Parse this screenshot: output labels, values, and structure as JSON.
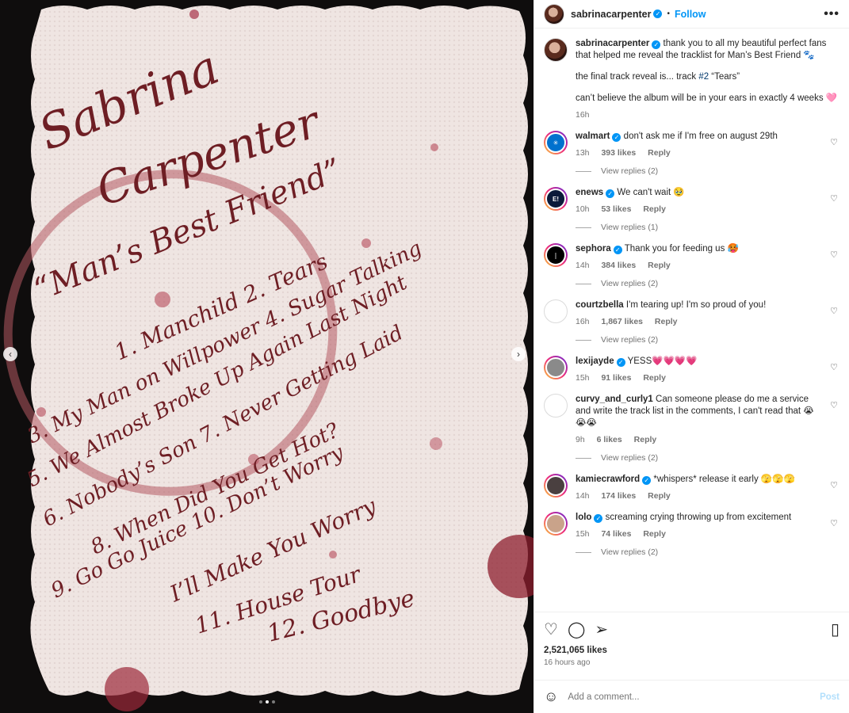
{
  "post": {
    "author": "sabrinacarpenter",
    "follow_label": "Follow",
    "more_label": "•••",
    "separator": "•"
  },
  "caption": {
    "author": "sabrinacarpenter",
    "line1": "thank you to all my beautiful perfect fans that helped me reveal the tracklist for Man’s Best Friend 🐾",
    "line2_pre": "the final track reveal is... track ",
    "line2_tag": "#2",
    "line2_post": " “Tears”",
    "line3": "can’t believe the album will be in your ears in exactly 4 weeks 🩷",
    "time": "16h"
  },
  "comments": [
    {
      "user": "walmart",
      "verified": true,
      "text": "don't ask me if I'm free on august 29th",
      "time": "13h",
      "likes": "393 likes",
      "reply": "Reply",
      "replies": "View replies (2)",
      "avatar_icon": "walmart-spark-icon",
      "avatar_color": "#0071ce"
    },
    {
      "user": "enews",
      "verified": true,
      "text": "We can't wait 🥹",
      "time": "10h",
      "likes": "53 likes",
      "reply": "Reply",
      "replies": "View replies (1)",
      "avatar_icon": "enews-logo-icon",
      "avatar_color": "#0b1a3a"
    },
    {
      "user": "sephora",
      "verified": true,
      "text": "Thank you for feeding us 🥵",
      "time": "14h",
      "likes": "384 likes",
      "reply": "Reply",
      "replies": "View replies (2)",
      "avatar_icon": "sephora-flame-icon",
      "avatar_color": "#000000"
    },
    {
      "user": "courtzbella",
      "verified": false,
      "text": "I'm tearing up! I'm so proud of you!",
      "time": "16h",
      "likes": "1,867 likes",
      "reply": "Reply",
      "replies": "View replies (2)",
      "avatar_icon": "user-photo-icon",
      "avatar_color": "#3a3230"
    },
    {
      "user": "lexijayde",
      "verified": true,
      "text": "YESS💗💗💗💗",
      "time": "15h",
      "likes": "91 likes",
      "reply": "Reply",
      "replies": "",
      "avatar_icon": "user-photo-icon",
      "avatar_color": "#8a8a8a"
    },
    {
      "user": "curvy_and_curly1",
      "verified": false,
      "text": "Can someone please do me a service and write the track list in the comments, I can't read that 😭😭😭",
      "time": "9h",
      "likes": "6 likes",
      "reply": "Reply",
      "replies": "View replies (2)",
      "avatar_icon": "user-photo-icon",
      "avatar_color": "#a89a8f"
    },
    {
      "user": "kamiecrawford",
      "verified": true,
      "text": "*whispers* release it early 🫣🫣🫣",
      "time": "14h",
      "likes": "174 likes",
      "reply": "Reply",
      "replies": "",
      "avatar_icon": "user-photo-icon",
      "avatar_color": "#4a4040"
    },
    {
      "user": "lolo",
      "verified": true,
      "text": "screaming crying throwing up from excitement",
      "time": "15h",
      "likes": "74 likes",
      "reply": "Reply",
      "replies": "View replies (2)",
      "avatar_icon": "user-photo-icon",
      "avatar_color": "#c9a38a"
    }
  ],
  "actions": {
    "likes": "2,521,065 likes",
    "time": "16 hours ago"
  },
  "composer": {
    "placeholder": "Add a comment...",
    "post_label": "Post"
  },
  "media": {
    "napkin_text": [
      "Sabrina",
      "Carpenter",
      "“Man’s Best Friend”",
      "1. Manchild 2. Tears",
      "3. My Man on Willpower 4. Sugar Talking",
      "5. We Almost Broke Up Again Last Night",
      "6. Nobody’s Son 7. Never Getting Laid",
      "8. When Did You Get Hot?",
      "9. Go Go Juice 10. Don’t Worry",
      "I’ll Make You Worry",
      "11. House Tour",
      "12. Goodbye"
    ],
    "dots": 3,
    "active_dot": 1
  }
}
